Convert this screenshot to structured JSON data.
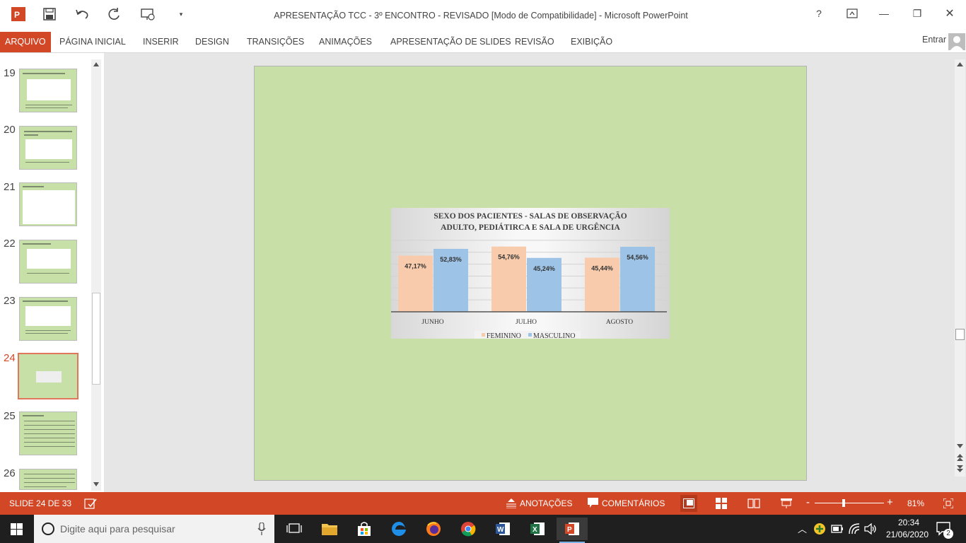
{
  "window": {
    "title": "APRESENTAÇÃO TCC - 3º ENCONTRO - REVISADO [Modo de Compatibilidade] - Microsoft PowerPoint",
    "help": "?",
    "restore_icon": "restore-icon",
    "minimize": "—",
    "maximize": "❐",
    "close": "✕"
  },
  "ribbon": {
    "tabs": [
      "ARQUIVO",
      "PÁGINA INICIAL",
      "INSERIR",
      "DESIGN",
      "TRANSIÇÕES",
      "ANIMAÇÕES",
      "APRESENTAÇÃO DE SLIDES",
      "REVISÃO",
      "EXIBIÇÃO"
    ],
    "signin": "Entrar"
  },
  "thumbnails": {
    "numbers": [
      "19",
      "20",
      "21",
      "22",
      "23",
      "24",
      "25",
      "26"
    ],
    "active": "24"
  },
  "chart_data": {
    "type": "bar",
    "title_line1": "SEXO DOS PACIENTES - SALAS DE OBSERVAÇÃO",
    "title_line2": "ADULTO, PEDIÁTIRCA E SALA DE URGÊNCIA",
    "categories": [
      "JUNHO",
      "JULHO",
      "AGOSTO"
    ],
    "series": [
      {
        "name": "FEMININO",
        "values": [
          47.17,
          54.76,
          45.44
        ],
        "labels": [
          "47,17%",
          "54,76%",
          "45,44%"
        ],
        "color": "#f8cbad"
      },
      {
        "name": "MASCULINO",
        "values": [
          52.83,
          45.24,
          54.56
        ],
        "labels": [
          "52,83%",
          "45,24%",
          "54,56%"
        ],
        "color": "#9dc3e6"
      }
    ],
    "ylim": [
      0,
      60
    ],
    "legend": "bottom",
    "grid": true
  },
  "statusbar": {
    "slide_info": "SLIDE 24 DE 33",
    "notes": "ANOTAÇÕES",
    "comments": "COMENTÁRIOS",
    "zoom_minus": "-",
    "zoom_plus": "+",
    "zoom": "81%",
    "zoom_fraction": 0.42
  },
  "taskbar": {
    "search_placeholder": "Digite aqui para pesquisar",
    "time": "20:34",
    "date": "21/06/2020",
    "notifications": "2"
  }
}
